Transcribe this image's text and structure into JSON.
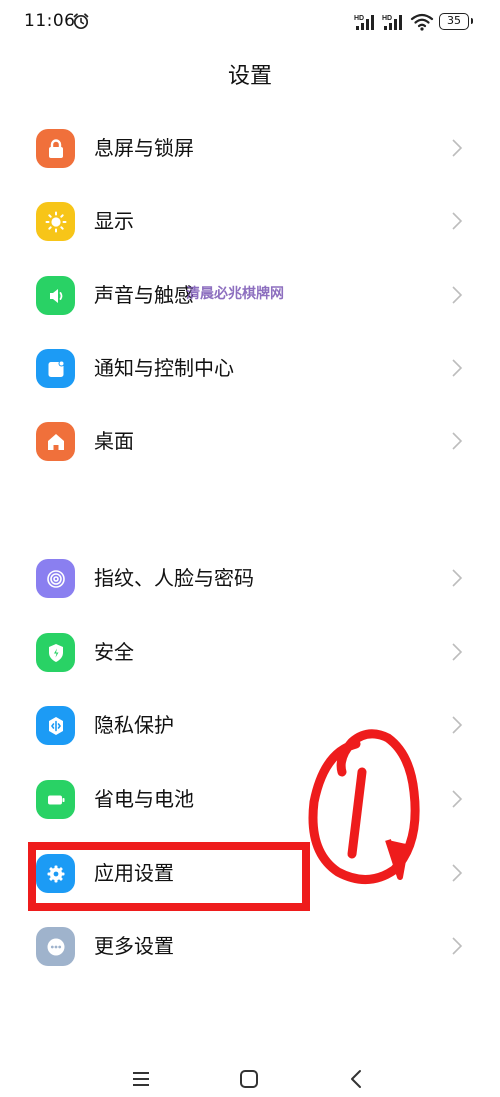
{
  "status_bar": {
    "time": "11:06",
    "signal_1_badge": "HD",
    "signal_2_badge": "HD",
    "battery": "35"
  },
  "header": {
    "title": "设置"
  },
  "settings_group_1": [
    {
      "label": "息屏与锁屏",
      "icon": "lock-icon",
      "color": "#f0703b"
    },
    {
      "label": "显示",
      "icon": "sun-icon",
      "color": "#f7c518"
    },
    {
      "label": "声音与触感",
      "icon": "speaker-icon",
      "color": "#29d265"
    },
    {
      "label": "通知与控制中心",
      "icon": "notification-icon",
      "color": "#1c9bf5"
    },
    {
      "label": "桌面",
      "icon": "home-icon",
      "color": "#f0703b"
    }
  ],
  "settings_group_2": [
    {
      "label": "指纹、人脸与密码",
      "icon": "fingerprint-icon",
      "color": "#8a7ff0"
    },
    {
      "label": "安全",
      "icon": "shield-icon",
      "color": "#29d265"
    },
    {
      "label": "隐私保护",
      "icon": "privacy-icon",
      "color": "#1c9bf5"
    },
    {
      "label": "省电与电池",
      "icon": "battery-icon",
      "color": "#29d265"
    },
    {
      "label": "应用设置",
      "icon": "gear-icon",
      "color": "#1c9bf5"
    },
    {
      "label": "更多设置",
      "icon": "more-icon",
      "color": "#9fb3cc"
    }
  ],
  "watermark": {
    "text": "清晨必兆棋牌网"
  },
  "annotation": {
    "color": "#ee1c1c"
  },
  "nav_bar": {
    "menu": "menu-icon",
    "home": "home-square-icon",
    "back": "back-icon"
  }
}
